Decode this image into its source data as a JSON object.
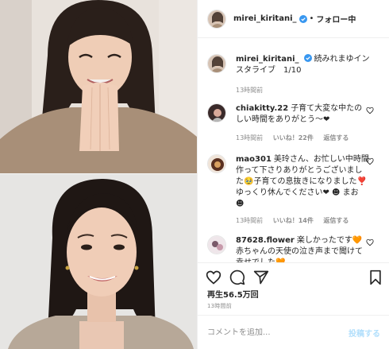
{
  "post": {
    "username": "mirei_kiritani_",
    "verified": true,
    "follow_label": "フォロー中",
    "dot": "•",
    "caption_text": "続みれまゆインスタライブ　1/10",
    "caption_time": "13時間前"
  },
  "comments": [
    {
      "user": "chiakitty.22",
      "text": "子育て大変な中たのしい時間をありがとう〜❤︎",
      "time": "13時間前",
      "likes": "いいね！22件",
      "reply": "返信する",
      "avatar_color": "#3a2a2a"
    },
    {
      "user": "mao301",
      "text": "美玲さん、お忙しい中時間作って下さりありがとうございました🥹子育ての息抜きになりました❣️ゆっくり休んでください❤︎ ☻ まお ☻",
      "time": "13時間前",
      "likes": "いいね！14件",
      "reply": "返信する",
      "avatar_color": "#5a3020"
    },
    {
      "user": "87628.flower",
      "text": "楽しかったです🧡赤ちゃんの天使の泣き声まで聞けて幸せでした🧡",
      "time": "",
      "likes": "",
      "reply": "",
      "avatar_color": "#7a5a6a"
    }
  ],
  "stats": {
    "views": "再生56.5万回",
    "time": "13時間前"
  },
  "compose": {
    "placeholder": "コメントを追加...",
    "post_label": "投稿する"
  },
  "icons": {
    "like": "heart-icon",
    "comment": "comment-icon",
    "share": "share-icon",
    "save": "bookmark-icon",
    "verified": "verified-badge-icon"
  },
  "colors": {
    "verified_blue": "#3897f0",
    "post_disabled": "#b2dffc",
    "meta_grey": "#8e8e8e"
  }
}
